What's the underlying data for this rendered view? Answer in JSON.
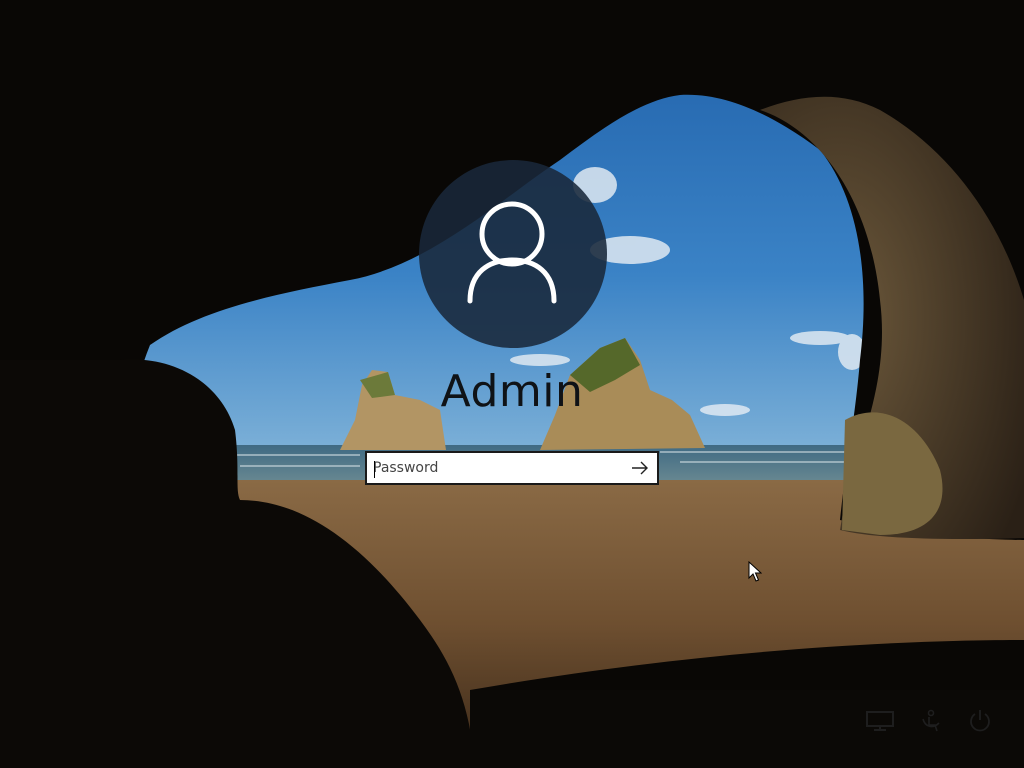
{
  "user": {
    "name": "Admin",
    "avatar_icon": "user-silhouette-icon"
  },
  "password": {
    "placeholder": "Password",
    "value": "",
    "submit_icon": "arrow-right-icon"
  },
  "tray": {
    "icons": [
      "network-icon",
      "ease-of-access-icon",
      "power-icon"
    ]
  },
  "colors": {
    "avatar_bg": "#19283a",
    "input_border": "#1a1a1a",
    "text_dark": "#0f1216"
  }
}
